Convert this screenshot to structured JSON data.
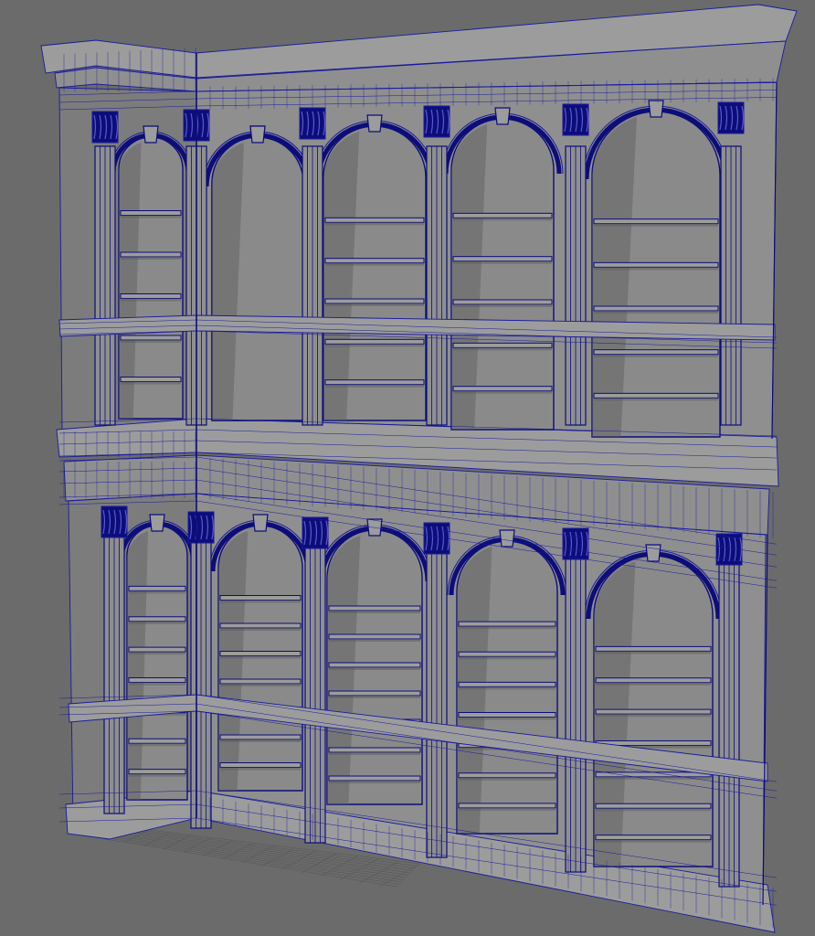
{
  "viewport": {
    "mode": "wireframe-on-shaded",
    "colors": {
      "background": "#6b6b6b",
      "surface": "#8f8f8f",
      "surface_light": "#9c9c9c",
      "surface_dark": "#7c7c7c",
      "niche": "#8a8a8a",
      "niche_shadow": "#5c5c5c",
      "wire": "#1a1a9e",
      "wire_dense": "#0d0d7a",
      "grid": "#555555"
    }
  },
  "model": {
    "upper_tier": {
      "arch_bays": 5,
      "side_bays": 1,
      "shelves_per_bay": 5
    },
    "lower_tier": {
      "arch_bays": 5,
      "side_bays": 1,
      "shelves_per_bay": 7
    },
    "pilaster_capital_icon": "corinthian-capital-icon",
    "keystone_icon": "keystone-icon"
  }
}
